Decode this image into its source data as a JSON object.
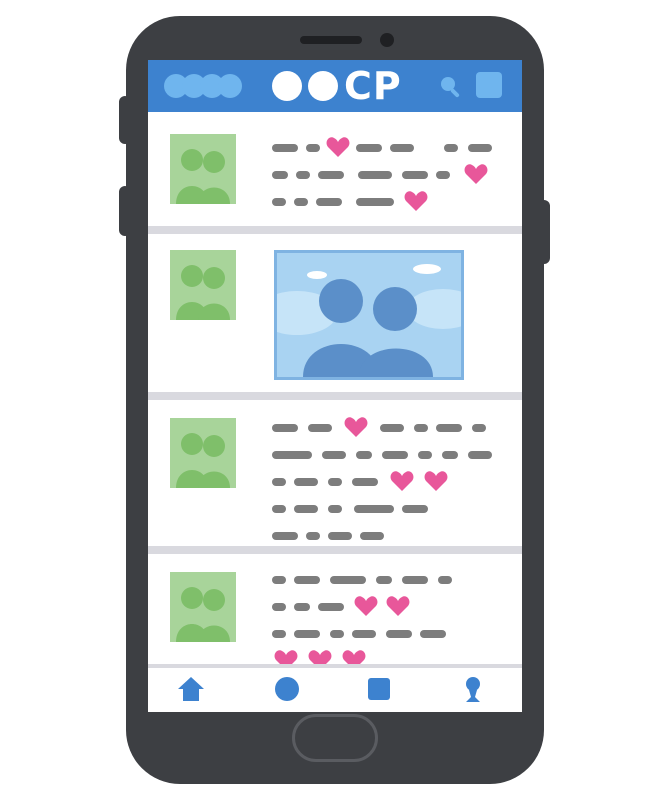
{
  "app": {
    "brand_label": "●●CP",
    "brand_text": "CP"
  },
  "colors": {
    "accent": "#3d82cf",
    "accent_light": "#6fb5ee",
    "avatar": "#a8d49a",
    "heart": "#e8579a",
    "text_dash": "#7d7d7d",
    "phone_body": "#3d3f43",
    "divider": "#d9d9df"
  },
  "header": {
    "menu_icon": "menu-dots-icon",
    "search_icon": "search-icon",
    "square_icon": "square-icon"
  },
  "feed": {
    "posts": [
      {
        "type": "text",
        "avatar_icon": "couple-avatar-icon",
        "line_count": 3,
        "heart_count": 3
      },
      {
        "type": "photo",
        "avatar_icon": "couple-avatar-icon",
        "image_icon": "couple-photo-icon"
      },
      {
        "type": "text",
        "avatar_icon": "couple-avatar-icon",
        "line_count": 5,
        "heart_count": 3
      },
      {
        "type": "text",
        "avatar_icon": "couple-avatar-icon",
        "line_count": 4,
        "heart_count": 5
      }
    ]
  },
  "bottom_nav": {
    "items": [
      {
        "icon": "home-icon"
      },
      {
        "icon": "circle-icon"
      },
      {
        "icon": "square-icon"
      },
      {
        "icon": "profile-icon"
      }
    ]
  }
}
